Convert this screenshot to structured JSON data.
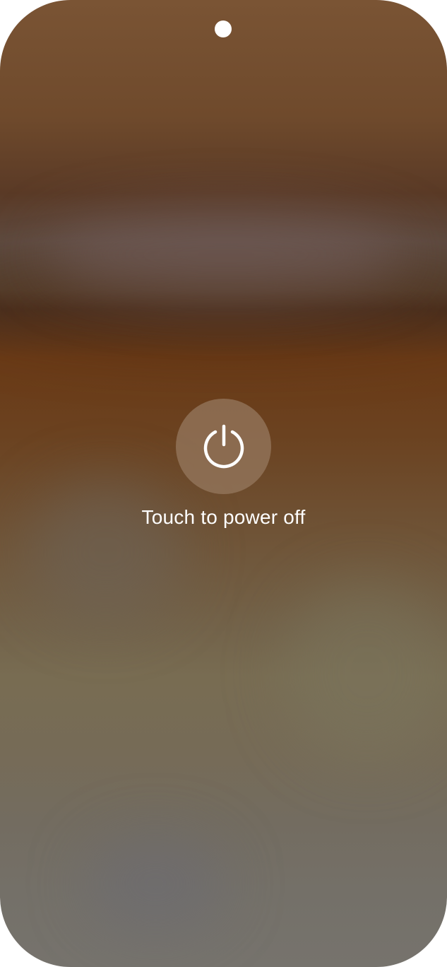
{
  "screen": {
    "name": "power-off-screen",
    "background_colors": [
      "#7a5434",
      "#6a3a16",
      "#786c52",
      "#76736d"
    ]
  },
  "camera": {
    "icon": "camera-punch-hole"
  },
  "power": {
    "icon": "power-icon",
    "label": "Touch to power off",
    "button_color": "#967a5f"
  }
}
